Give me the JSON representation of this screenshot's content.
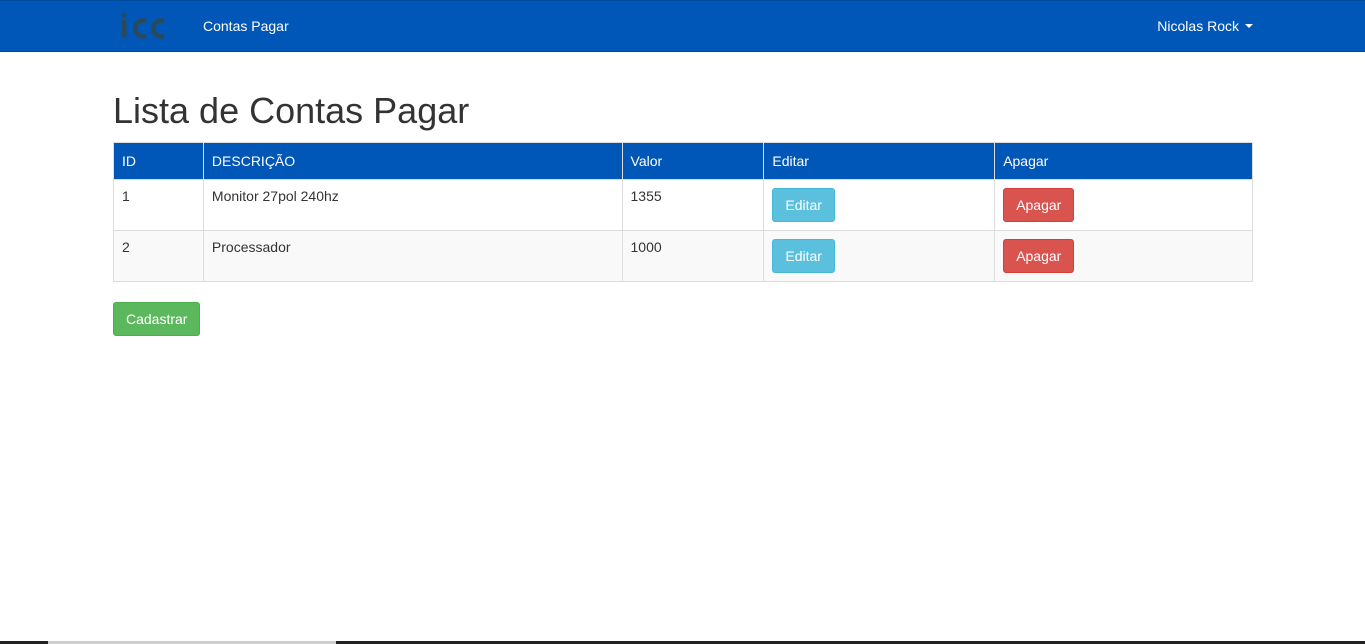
{
  "navbar": {
    "brand_logo": "icc-logo",
    "nav_link": "Contas Pagar",
    "user_name": "Nicolas Rock",
    "user_caret_icon": "caret-down-icon",
    "background_color": "#0057b7"
  },
  "page": {
    "title": "Lista de Contas Pagar"
  },
  "table": {
    "headers": {
      "id": "ID",
      "descricao": "DESCRIÇÃO",
      "valor": "Valor",
      "editar": "Editar",
      "apagar": "Apagar"
    },
    "rows": [
      {
        "id": "1",
        "descricao": "Monitor 27pol 240hz",
        "valor": "1355",
        "edit_label": "Editar",
        "delete_label": "Apagar"
      },
      {
        "id": "2",
        "descricao": "Processador",
        "valor": "1000",
        "edit_label": "Editar",
        "delete_label": "Apagar"
      }
    ]
  },
  "actions": {
    "create_label": "Cadastrar"
  },
  "colors": {
    "info": "#5bc0de",
    "danger": "#d9534f",
    "success": "#5cb85c"
  }
}
